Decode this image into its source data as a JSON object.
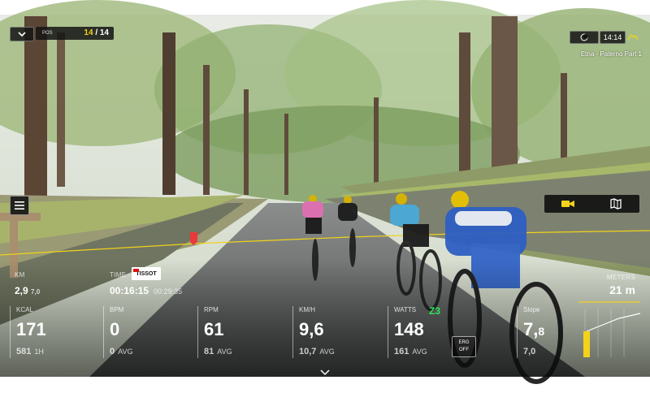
{
  "topbar": {
    "position_label": "POS",
    "position_current": "14",
    "position_total": "/ 14",
    "clock": "14:14",
    "course_name": "Etna - Paterno Part 1"
  },
  "stats": {
    "km_label": "KM",
    "km_value": "2,9",
    "km_sub": "7,0",
    "time_label": "TIME",
    "time_value": "00:16:15",
    "time_remaining": "00:29:35",
    "sponsor": "TISSOT",
    "meters_label": "METERS",
    "meters_value": "21 m"
  },
  "metrics": [
    {
      "label": "KCAL",
      "value": "171",
      "sub": "581",
      "sub_unit": "1H"
    },
    {
      "label": "BPM",
      "value": "0",
      "sub": "0",
      "sub_unit": "AVG"
    },
    {
      "label": "RPM",
      "value": "61",
      "sub": "81",
      "sub_unit": "AVG"
    },
    {
      "label": "KM/H",
      "value": "9,6",
      "sub": "10,7",
      "sub_unit": "AVG"
    },
    {
      "label": "WATTS",
      "value": "148",
      "sub": "161",
      "sub_unit": "AVG"
    }
  ],
  "power_zone": "Z3",
  "erg_button": {
    "line1": "ERG",
    "line2": "OFF"
  },
  "slope": {
    "label": "Slope",
    "value": "7,",
    "value_dec": "8",
    "sub": "7,0"
  },
  "icons": {
    "collapse": "chevron-down-icon",
    "theme": "moon-icon",
    "climb": "mountain-icon",
    "menu": "hamburger-menu-icon",
    "camera": "video-camera-icon",
    "map": "map-icon",
    "scroll": "chevron-down-icon"
  },
  "colors": {
    "accent": "#f2d21a",
    "zone": "#2ee65a",
    "panel": "#141414"
  }
}
